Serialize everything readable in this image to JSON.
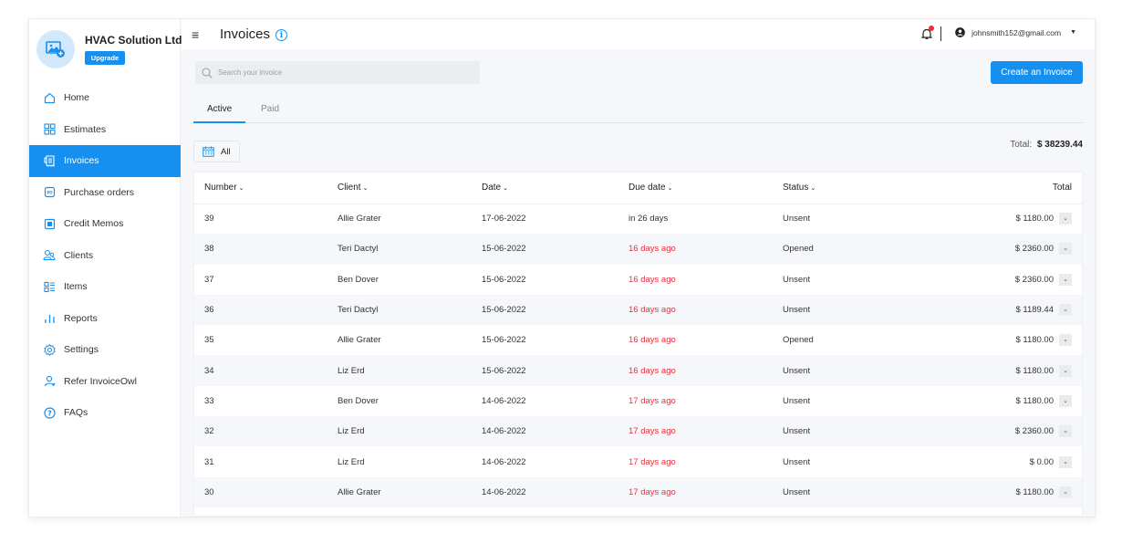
{
  "company": {
    "name": "HVAC Solution Ltd",
    "upgrade_label": "Upgrade"
  },
  "sidebar": {
    "items": [
      {
        "label": "Home",
        "icon": "home-icon",
        "active": false
      },
      {
        "label": "Estimates",
        "icon": "estimates-icon",
        "active": false
      },
      {
        "label": "Invoices",
        "icon": "invoices-icon",
        "active": true
      },
      {
        "label": "Purchase orders",
        "icon": "purchase-order-icon",
        "active": false
      },
      {
        "label": "Credit Memos",
        "icon": "credit-memo-icon",
        "active": false
      },
      {
        "label": "Clients",
        "icon": "clients-icon",
        "active": false
      },
      {
        "label": "Items",
        "icon": "items-icon",
        "active": false
      },
      {
        "label": "Reports",
        "icon": "reports-icon",
        "active": false
      },
      {
        "label": "Settings",
        "icon": "settings-icon",
        "active": false
      },
      {
        "label": "Refer InvoiceOwl",
        "icon": "refer-icon",
        "active": false
      },
      {
        "label": "FAQs",
        "icon": "faq-icon",
        "active": false
      }
    ]
  },
  "header": {
    "title": "Invoices",
    "user_email": "johnsmith152@gmail.com"
  },
  "toolbar": {
    "search_placeholder": "Search your invoice",
    "create_label": "Create an Invoice",
    "tabs": [
      {
        "label": "Active",
        "active": true
      },
      {
        "label": "Paid",
        "active": false
      }
    ],
    "filter_label": "All",
    "total_label": "Total:",
    "total_value": "$ 38239.44"
  },
  "table": {
    "columns": [
      "Number",
      "Client",
      "Date",
      "Due date",
      "Status",
      "Total"
    ],
    "rows": [
      {
        "number": "39",
        "client": "Allie Grater",
        "date": "17-06-2022",
        "due": "in 26 days",
        "overdue": false,
        "status": "Unsent",
        "total": "$ 1180.00"
      },
      {
        "number": "38",
        "client": "Teri Dactyl",
        "date": "15-06-2022",
        "due": "16 days ago",
        "overdue": true,
        "status": "Opened",
        "total": "$ 2360.00"
      },
      {
        "number": "37",
        "client": "Ben Dover",
        "date": "15-06-2022",
        "due": "16 days ago",
        "overdue": true,
        "status": "Unsent",
        "total": "$ 2360.00"
      },
      {
        "number": "36",
        "client": "Teri Dactyl",
        "date": "15-06-2022",
        "due": "16 days ago",
        "overdue": true,
        "status": "Unsent",
        "total": "$ 1189.44"
      },
      {
        "number": "35",
        "client": "Allie Grater",
        "date": "15-06-2022",
        "due": "16 days ago",
        "overdue": true,
        "status": "Opened",
        "total": "$ 1180.00"
      },
      {
        "number": "34",
        "client": "Liz Erd",
        "date": "15-06-2022",
        "due": "16 days ago",
        "overdue": true,
        "status": "Unsent",
        "total": "$ 1180.00"
      },
      {
        "number": "33",
        "client": "Ben Dover",
        "date": "14-06-2022",
        "due": "17 days ago",
        "overdue": true,
        "status": "Unsent",
        "total": "$ 1180.00"
      },
      {
        "number": "32",
        "client": "Liz Erd",
        "date": "14-06-2022",
        "due": "17 days ago",
        "overdue": true,
        "status": "Unsent",
        "total": "$ 2360.00"
      },
      {
        "number": "31",
        "client": "Liz Erd",
        "date": "14-06-2022",
        "due": "17 days ago",
        "overdue": true,
        "status": "Unsent",
        "total": "$ 0.00"
      },
      {
        "number": "30",
        "client": "Allie Grater",
        "date": "14-06-2022",
        "due": "17 days ago",
        "overdue": true,
        "status": "Unsent",
        "total": "$ 1180.00"
      }
    ]
  },
  "colors": {
    "accent": "#1690f0",
    "overdue": "#ee2f3f",
    "notification_dot": "#f0283c"
  }
}
